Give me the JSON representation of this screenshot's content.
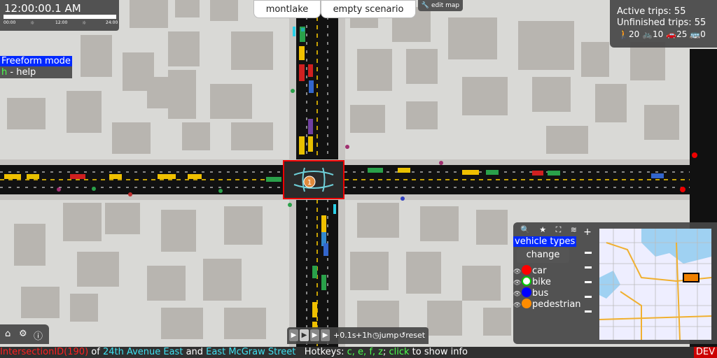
{
  "clock": {
    "time": "12:00:00.1 AM",
    "progress_fraction": 0.0,
    "tick_labels": [
      "00:00",
      "12:00",
      "24:00"
    ]
  },
  "top": {
    "map_name": "montlake",
    "scenario": "empty scenario",
    "edit_map": "edit map"
  },
  "trips": {
    "active": "Active trips: 55",
    "unfinished": "Unfinished trips: 55",
    "pedestrians": "20",
    "bikes": "10",
    "cars": "25",
    "buses": "0"
  },
  "mode": {
    "title": "Freeform mode",
    "help_key": "h",
    "help_text": " - help"
  },
  "minimap": {
    "panel_title": "vehicle types",
    "change_label": "change",
    "legend": [
      {
        "label": "car",
        "color": "#ff0000"
      },
      {
        "label": "bike",
        "color": "#00cc00"
      },
      {
        "label": "bus",
        "color": "#0000ff"
      },
      {
        "label": "pedestrian",
        "color": "#ff8c00"
      }
    ],
    "zoom_plus": "+",
    "zoom_minus": "−"
  },
  "intersection": {
    "number": "1"
  },
  "speed": {
    "step": "+0.1s",
    "hour": "+1h",
    "jump": "jump",
    "reset": "reset"
  },
  "bottom": {
    "prefix": "IntersectionID(190)",
    "of": " of ",
    "street1": "24th Avenue East",
    "and": " and ",
    "street2": "East McGraw Street",
    "hotkeys_label": "   Hotkeys: ",
    "hotkeys": "c, e, f, z",
    "sep": "; ",
    "click": "click",
    "tail": " to show info",
    "dev": "DEV"
  },
  "icons": {
    "home": "home-icon",
    "settings": "gear-icon",
    "info": "info-icon",
    "search": "search-icon",
    "star": "star-icon",
    "fullscreen": "fullscreen-icon",
    "layers": "layers-icon"
  }
}
